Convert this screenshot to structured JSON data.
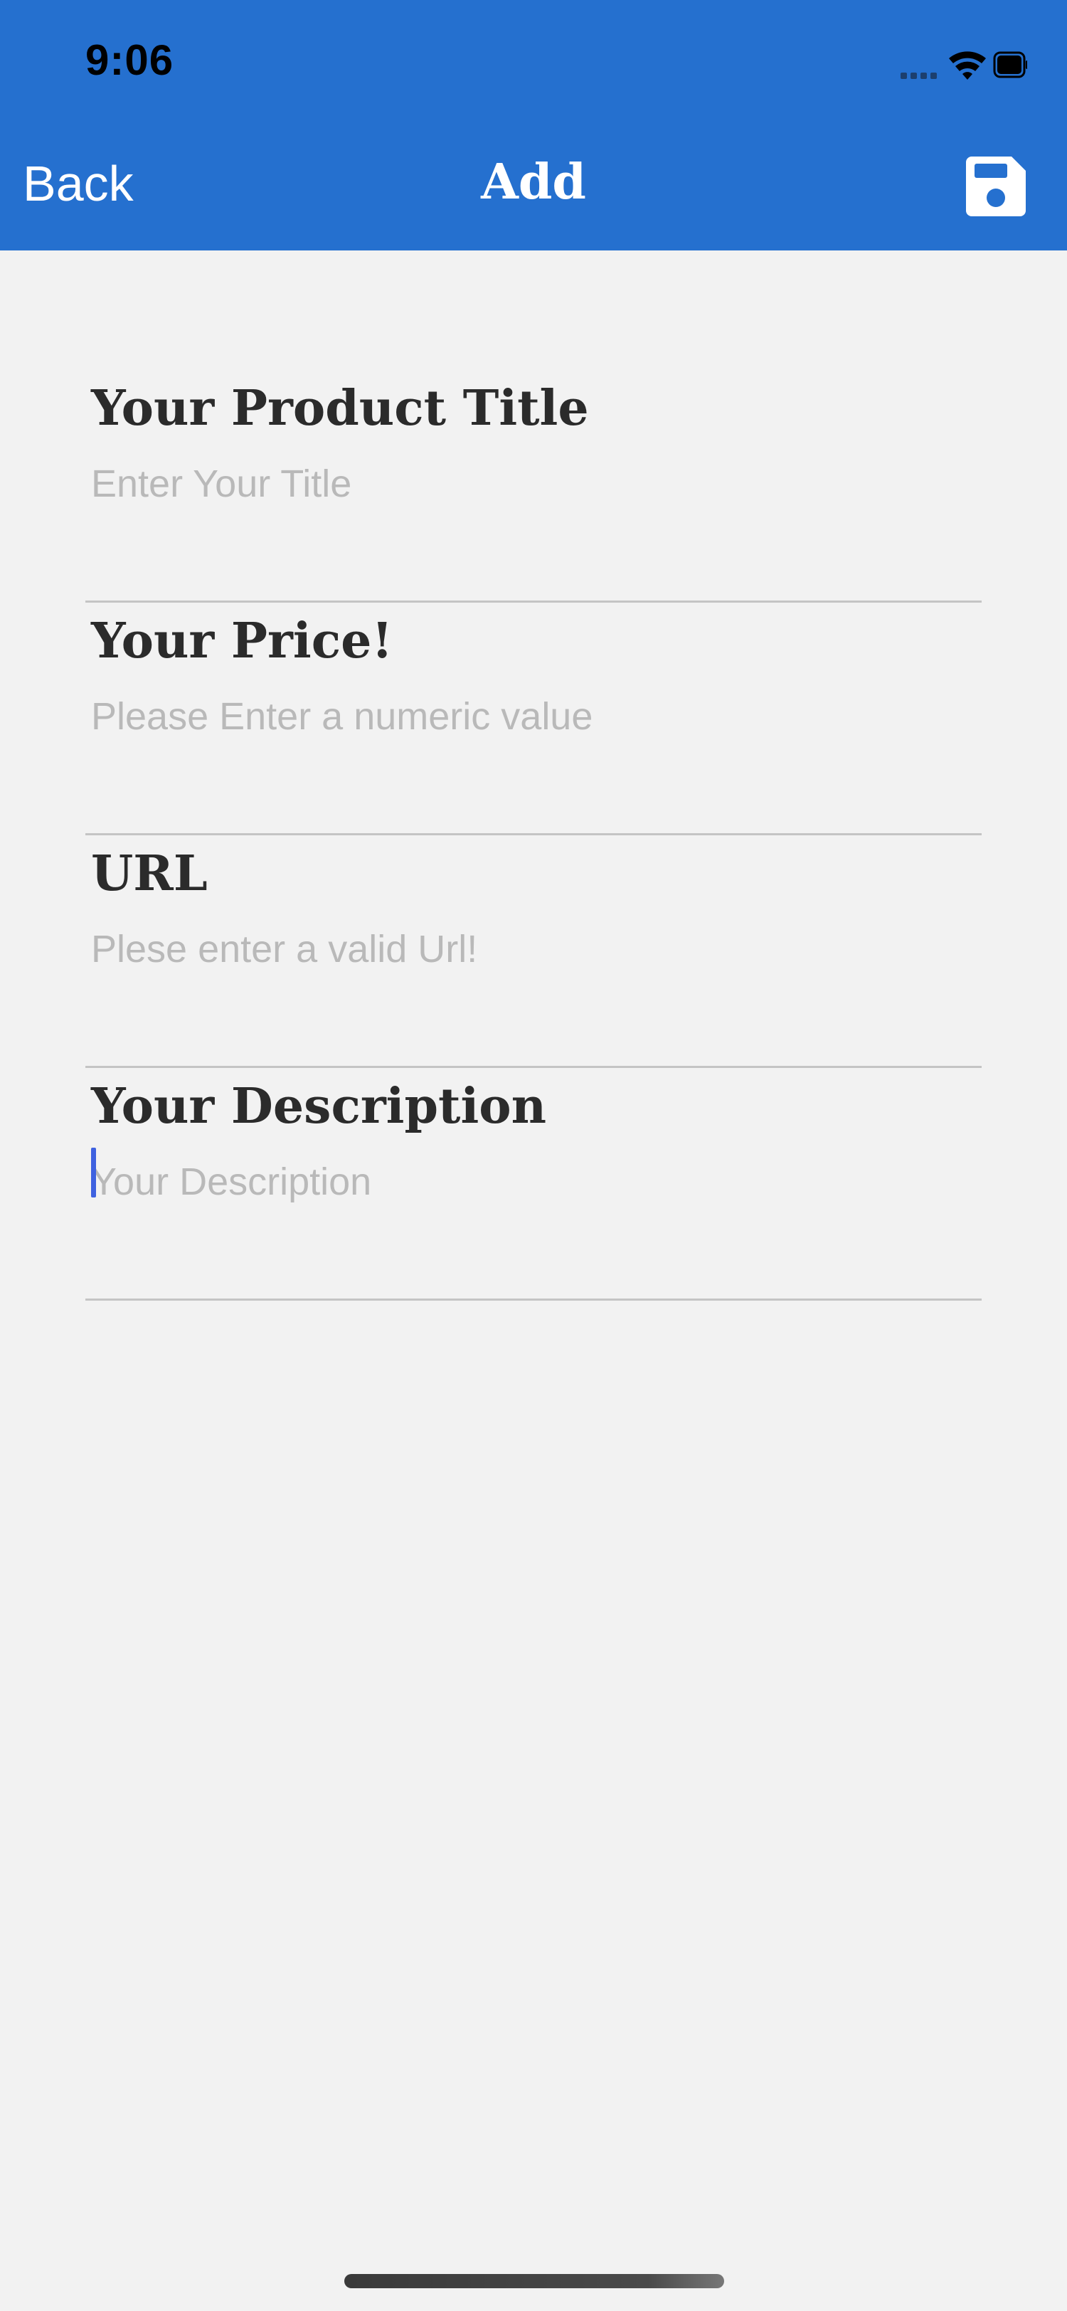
{
  "status_bar": {
    "time": "9:06",
    "icons": [
      "signal-icon",
      "wifi-icon",
      "battery-icon"
    ]
  },
  "nav": {
    "back_label": "Back",
    "title": "Add",
    "save_icon": "save-icon"
  },
  "form": {
    "fields": [
      {
        "label": "Your Product Title",
        "placeholder": "Enter Your Title",
        "value": ""
      },
      {
        "label": "Your Price!",
        "placeholder": "Please Enter a numeric value",
        "value": ""
      },
      {
        "label": "URL",
        "placeholder": "Plese enter a valid Url!",
        "value": ""
      },
      {
        "label": "Your Description",
        "placeholder": "Your Description",
        "value": ""
      }
    ]
  },
  "colors": {
    "header": "#2570cf",
    "background": "#f2f2f2",
    "label": "#2b2b2b",
    "placeholder": "#b9b9b9",
    "divider": "#c4c4c4",
    "cursor": "#3f62e0"
  }
}
